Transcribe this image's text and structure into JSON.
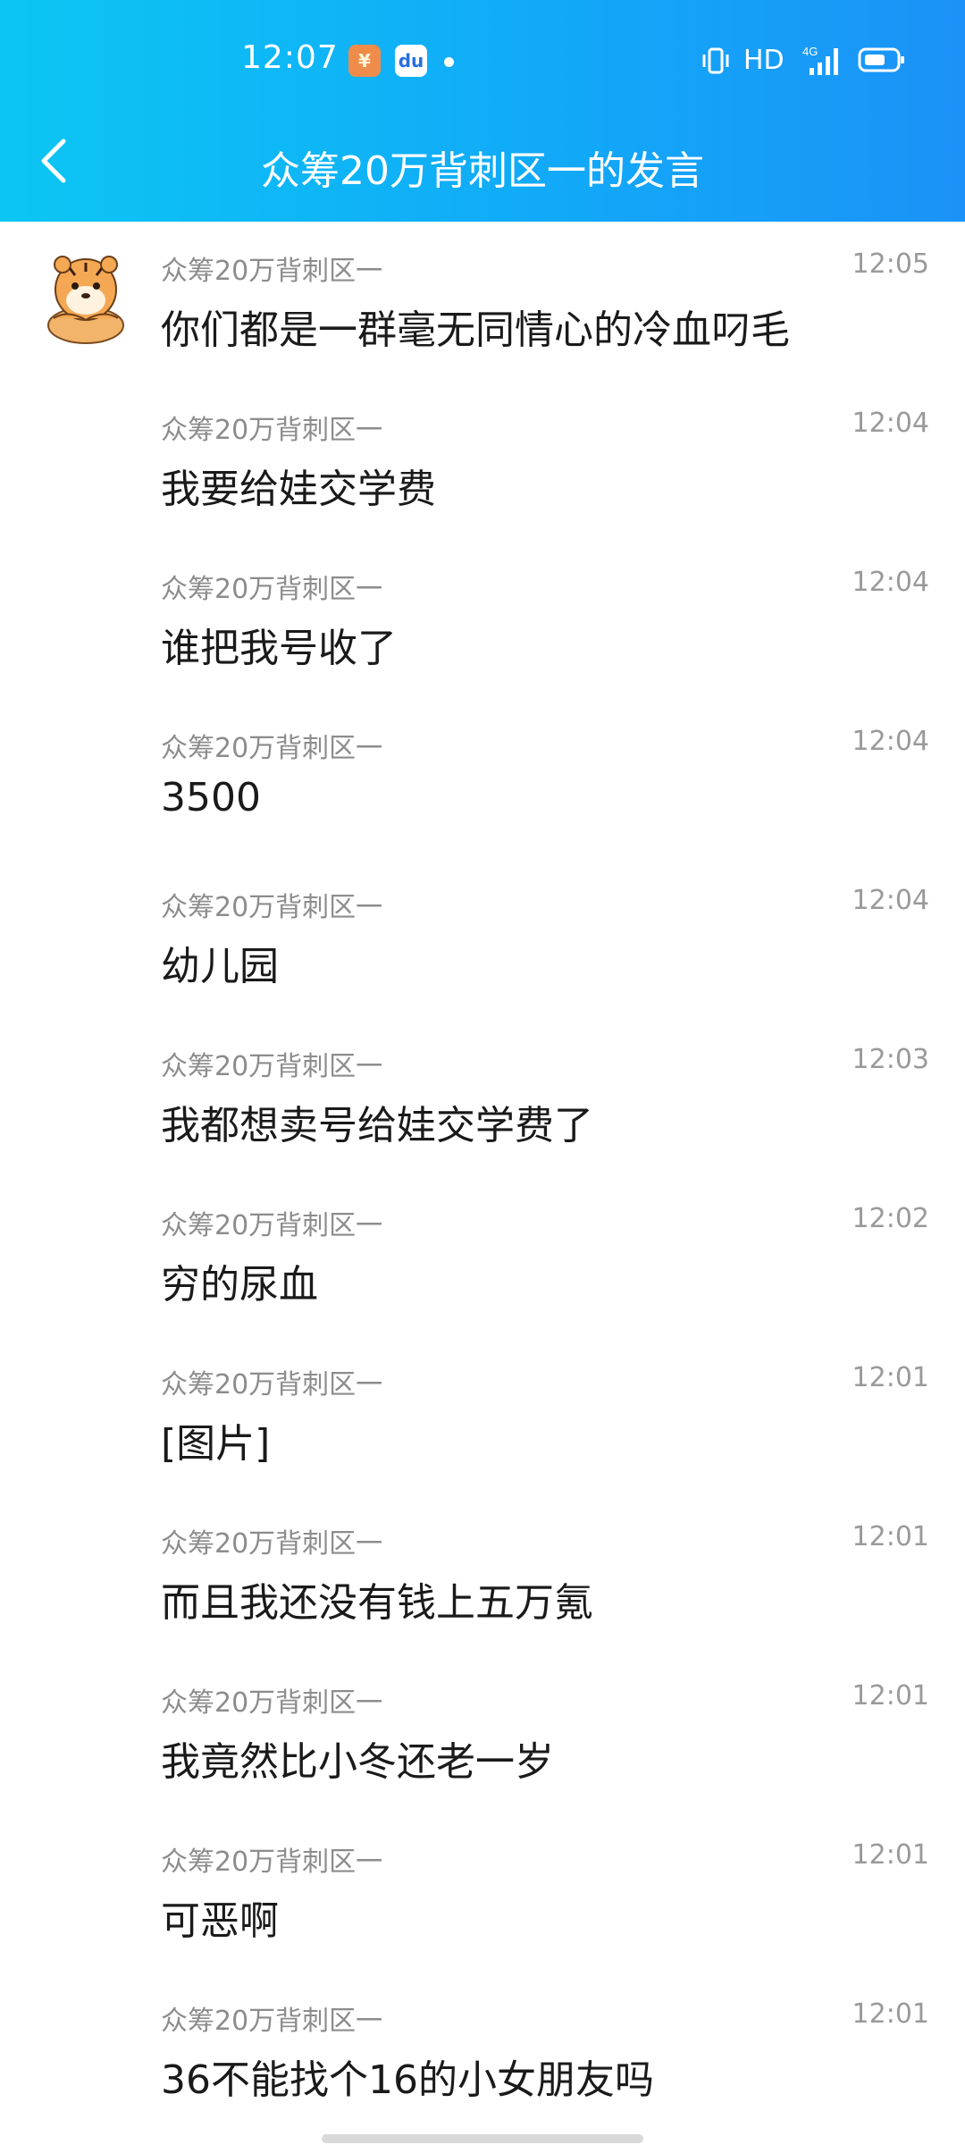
{
  "status_bar": {
    "time": "12:07",
    "app_icon_1": "¥",
    "app_icon_2": "du",
    "network_label": "HD",
    "signal_label": "4G"
  },
  "header": {
    "title": "众筹20万背刺区一的发言",
    "back_icon": "chevron-left-icon"
  },
  "messages": [
    {
      "sender": "众筹20万背刺区一",
      "time": "12:05",
      "text": "你们都是一群毫无同情心的冷血叼毛"
    },
    {
      "sender": "众筹20万背刺区一",
      "time": "12:04",
      "text": "我要给娃交学费"
    },
    {
      "sender": "众筹20万背刺区一",
      "time": "12:04",
      "text": "谁把我号收了"
    },
    {
      "sender": "众筹20万背刺区一",
      "time": "12:04",
      "text": "3500"
    },
    {
      "sender": "众筹20万背刺区一",
      "time": "12:04",
      "text": "幼儿园"
    },
    {
      "sender": "众筹20万背刺区一",
      "time": "12:03",
      "text": "我都想卖号给娃交学费了"
    },
    {
      "sender": "众筹20万背刺区一",
      "time": "12:02",
      "text": "穷的尿血"
    },
    {
      "sender": "众筹20万背刺区一",
      "time": "12:01",
      "text": "[图片]"
    },
    {
      "sender": "众筹20万背刺区一",
      "time": "12:01",
      "text": "而且我还没有钱上五万氪"
    },
    {
      "sender": "众筹20万背刺区一",
      "time": "12:01",
      "text": "我竟然比小冬还老一岁"
    },
    {
      "sender": "众筹20万背刺区一",
      "time": "12:01",
      "text": "可恶啊"
    },
    {
      "sender": "众筹20万背刺区一",
      "time": "12:01",
      "text": "36不能找个16的小女朋友吗"
    }
  ],
  "colors": {
    "header_start": "#0bc6f4",
    "header_end": "#1b92f7",
    "sender_gray": "#8c8c8c",
    "text_dark": "#1a1a1a"
  }
}
